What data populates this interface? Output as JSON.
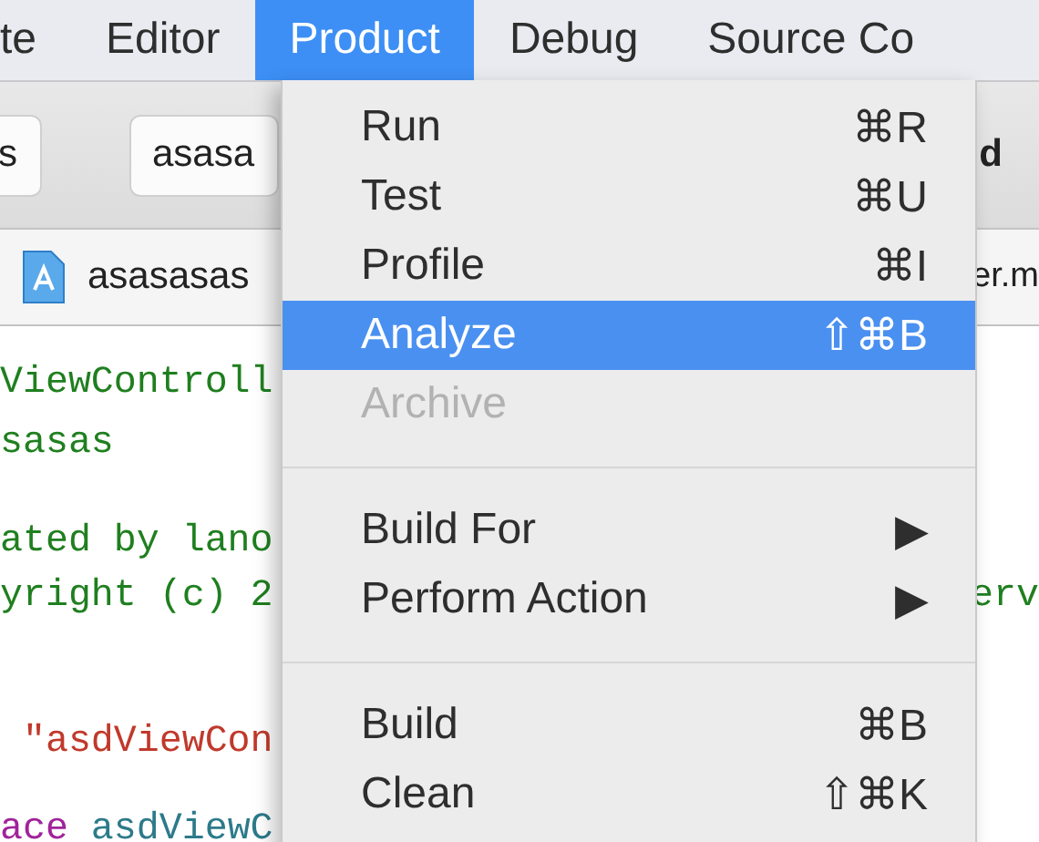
{
  "menu_bar": [
    {
      "label": "te",
      "selected": false
    },
    {
      "label": "Editor",
      "selected": false
    },
    {
      "label": "Product",
      "selected": true
    },
    {
      "label": "Debug",
      "selected": false
    },
    {
      "label": "Source Co",
      "selected": false
    }
  ],
  "toolbar": {
    "left_button": "s",
    "scheme_button": "asasa",
    "right_text": "d"
  },
  "path_bar": {
    "file": "asasasas",
    "right_text": "er.m"
  },
  "code_lines": [
    {
      "segments": [
        {
          "text": "ViewControll",
          "kind": "comment"
        }
      ]
    },
    {
      "segments": [
        {
          "text": "sasas",
          "kind": "comment"
        }
      ]
    },
    {
      "segments": [
        {
          "text": "ated by lano",
          "kind": "comment"
        }
      ]
    },
    {
      "segments": [
        {
          "text": "yright (c) 2",
          "kind": "comment"
        }
      ],
      "right": {
        "text": "erv",
        "kind": "comment"
      }
    },
    {
      "segments": [
        {
          "text": " \"asdViewCon",
          "kind": "string"
        }
      ]
    },
    {
      "segments": [
        {
          "text": "ace",
          "kind": "keyword"
        },
        {
          "text": " asdViewC",
          "kind": "type"
        }
      ]
    }
  ],
  "menu": {
    "items": [
      {
        "kind": "item",
        "label": "Run",
        "shortcut": "⌘R",
        "selected": false,
        "disabled": false
      },
      {
        "kind": "item",
        "label": "Test",
        "shortcut": "⌘U",
        "selected": false,
        "disabled": false
      },
      {
        "kind": "item",
        "label": "Profile",
        "shortcut": "⌘I",
        "selected": false,
        "disabled": false
      },
      {
        "kind": "item",
        "label": "Analyze",
        "shortcut": "⇧⌘B",
        "selected": true,
        "disabled": false
      },
      {
        "kind": "item",
        "label": "Archive",
        "selected": false,
        "disabled": true
      },
      {
        "kind": "separator"
      },
      {
        "kind": "submenu",
        "label": "Build For",
        "arrow": "▶",
        "selected": false,
        "disabled": false
      },
      {
        "kind": "submenu",
        "label": "Perform Action",
        "arrow": "▶",
        "selected": false,
        "disabled": false
      },
      {
        "kind": "separator"
      },
      {
        "kind": "item",
        "label": "Build",
        "shortcut": "⌘B",
        "selected": false,
        "disabled": false
      },
      {
        "kind": "item",
        "label": "Clean",
        "shortcut": "⇧⌘K",
        "selected": false,
        "disabled": false
      }
    ]
  }
}
